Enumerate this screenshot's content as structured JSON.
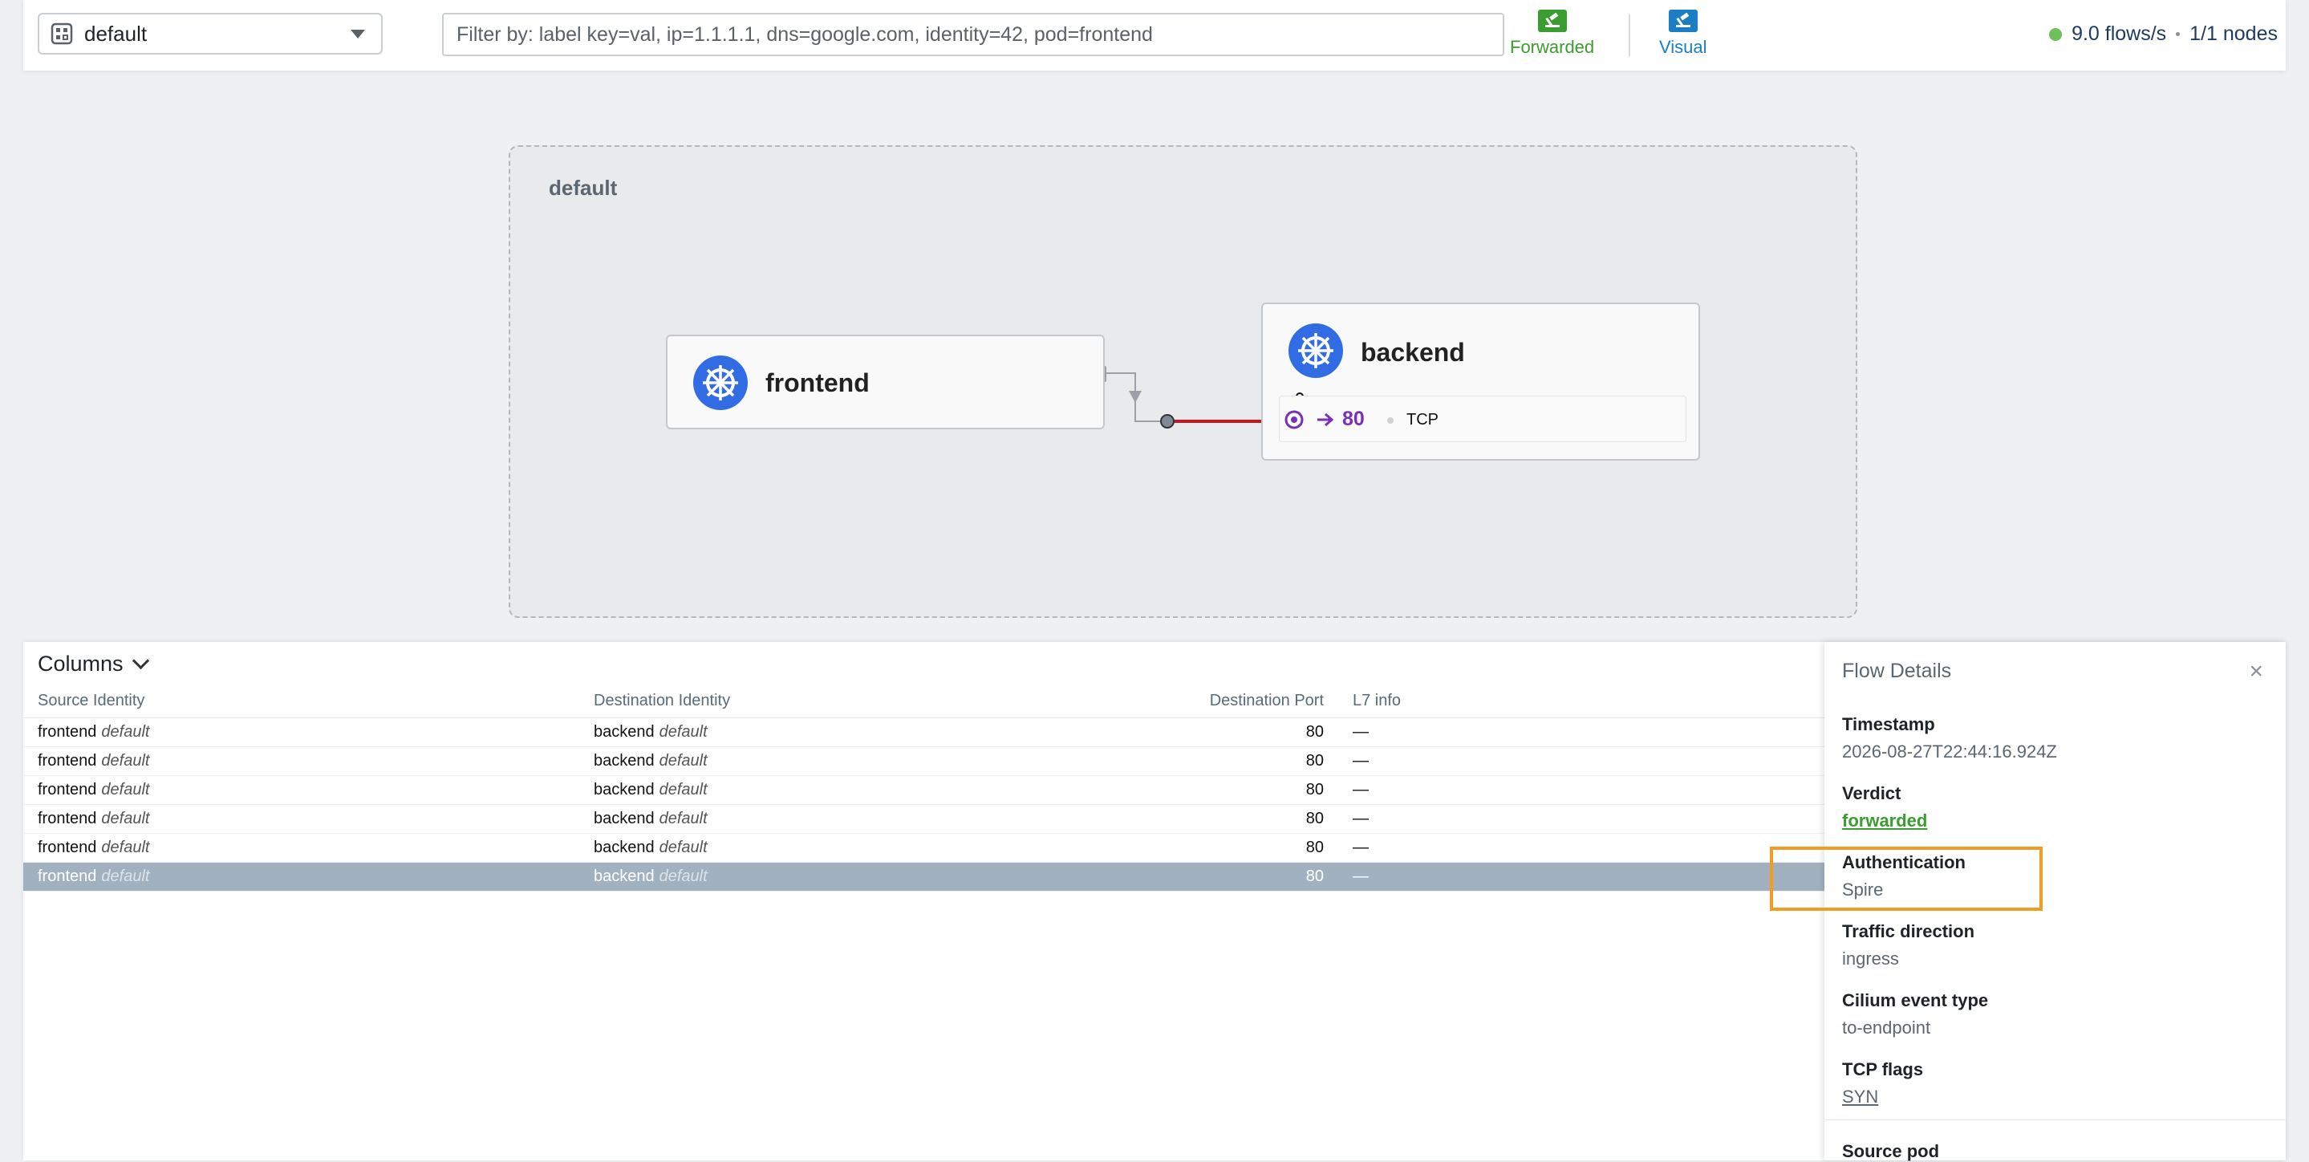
{
  "header": {
    "namespace": "default",
    "filter_placeholder": "Filter by: label key=val, ip=1.1.1.1, dns=google.com, identity=42, pod=frontend",
    "toggles": {
      "forwarded": "Forwarded",
      "visual": "Visual"
    },
    "flows_rate": "9.0 flows/s",
    "nodes": "1/1 nodes"
  },
  "map": {
    "namespace_label": "default",
    "services": {
      "frontend": "frontend",
      "backend": "backend"
    },
    "backend_port": {
      "port": "80",
      "protocol": "TCP"
    }
  },
  "table": {
    "columns_toggle": "Columns",
    "headers": [
      "Source Identity",
      "Destination Identity",
      "Destination Port",
      "L7 info"
    ],
    "rows": [
      {
        "src": "frontend",
        "src_ns": "default",
        "dst": "backend",
        "dst_ns": "default",
        "port": "80",
        "l7": "—"
      },
      {
        "src": "frontend",
        "src_ns": "default",
        "dst": "backend",
        "dst_ns": "default",
        "port": "80",
        "l7": "—"
      },
      {
        "src": "frontend",
        "src_ns": "default",
        "dst": "backend",
        "dst_ns": "default",
        "port": "80",
        "l7": "—"
      },
      {
        "src": "frontend",
        "src_ns": "default",
        "dst": "backend",
        "dst_ns": "default",
        "port": "80",
        "l7": "—"
      },
      {
        "src": "frontend",
        "src_ns": "default",
        "dst": "backend",
        "dst_ns": "default",
        "port": "80",
        "l7": "—"
      },
      {
        "src": "frontend",
        "src_ns": "default",
        "dst": "backend",
        "dst_ns": "default",
        "port": "80",
        "l7": "—"
      }
    ]
  },
  "details": {
    "title": "Flow Details",
    "close": "×",
    "timestamp_label": "Timestamp",
    "timestamp": "2026-08-27T22:44:16.924Z",
    "verdict_label": "Verdict",
    "verdict": "forwarded",
    "auth_label": "Authentication",
    "auth": "Spire",
    "direction_label": "Traffic direction",
    "direction": "ingress",
    "event_label": "Cilium event type",
    "event": "to-endpoint",
    "tcp_label": "TCP flags",
    "tcp": "SYN",
    "source_pod_label": "Source pod"
  },
  "colors": {
    "forwarded": "#3b9c2f",
    "visual": "#1a7dc5",
    "link_red": "#c8161d",
    "port_purple": "#7b2fb5",
    "highlight": "#f39c24"
  }
}
